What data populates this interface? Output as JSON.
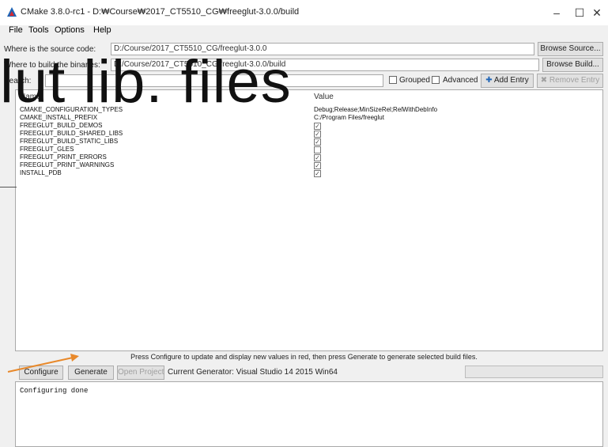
{
  "window": {
    "title": "CMake 3.8.0-rc1 - D:₩Course₩2017_CT5510_CG₩freeglut-3.0.0/build",
    "controls": {
      "minimize": "–",
      "maximize": "☐",
      "close": "✕"
    }
  },
  "menu": {
    "items": [
      "File",
      "Tools",
      "Options",
      "Help"
    ]
  },
  "source": {
    "label": "Where is the source code:",
    "value": "D:/Course/2017_CT5510_CG/freeglut-3.0.0",
    "button": "Browse Source..."
  },
  "build": {
    "label": "Where to build the binaries:",
    "value": "D:/Course/2017_CT5510_CG/freeglut-3.0.0/build",
    "button": "Browse Build..."
  },
  "search": {
    "label": "Search:",
    "value": "",
    "grouped": "Grouped",
    "advanced": "Advanced",
    "add_entry": "Add Entry",
    "remove_entry": "Remove Entry"
  },
  "table": {
    "headers": {
      "name": "Name",
      "value": "Value"
    },
    "rows": [
      {
        "name": "CMAKE_CONFIGURATION_TYPES",
        "value": "Debug;Release;MinSizeRel;RelWithDebInfo",
        "type": "text"
      },
      {
        "name": "CMAKE_INSTALL_PREFIX",
        "value": "C:/Program Files/freeglut",
        "type": "text"
      },
      {
        "name": "FREEGLUT_BUILD_DEMOS",
        "value": "checked",
        "type": "checkbox"
      },
      {
        "name": "FREEGLUT_BUILD_SHARED_LIBS",
        "value": "checked",
        "type": "checkbox"
      },
      {
        "name": "FREEGLUT_BUILD_STATIC_LIBS",
        "value": "checked",
        "type": "checkbox"
      },
      {
        "name": "FREEGLUT_GLES",
        "value": "unchecked",
        "type": "checkbox"
      },
      {
        "name": "FREEGLUT_PRINT_ERRORS",
        "value": "checked",
        "type": "checkbox"
      },
      {
        "name": "FREEGLUT_PRINT_WARNINGS",
        "value": "checked",
        "type": "checkbox"
      },
      {
        "name": "INSTALL_PDB",
        "value": "checked",
        "type": "checkbox"
      }
    ]
  },
  "status": {
    "text": "Press Configure to update and display new values in red, then press Generate to generate selected build files."
  },
  "actions": {
    "configure": "Configure",
    "generate": "Generate",
    "open_project": "Open Project",
    "generator": "Current Generator: Visual Studio 14 2015 Win64"
  },
  "output": {
    "text": "Configuring done"
  },
  "overlay": {
    "text": "lut lib. files"
  },
  "colors": {
    "arrow": "#e8892b",
    "accent": "#1f64b5"
  }
}
